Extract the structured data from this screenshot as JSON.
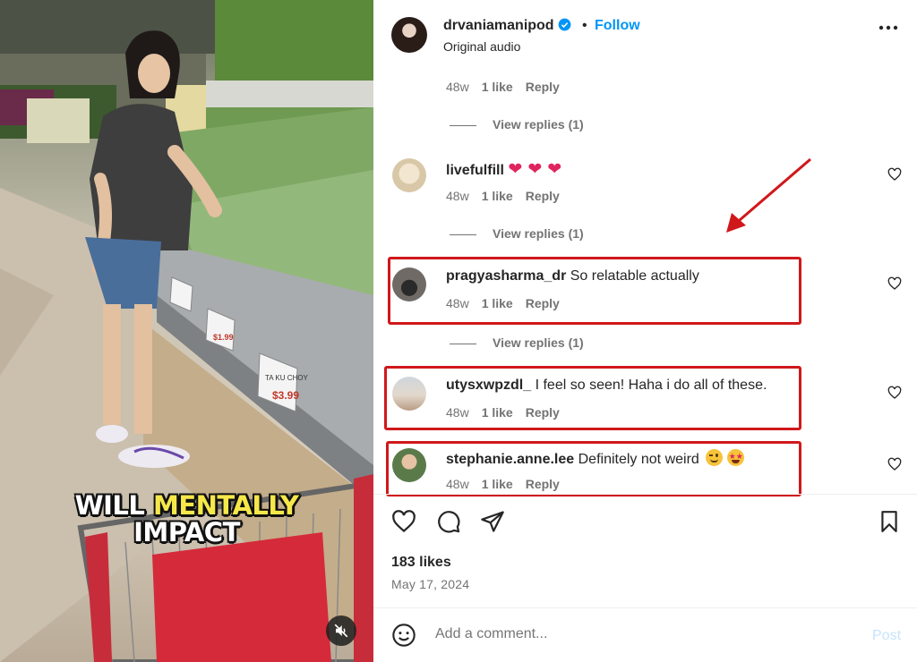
{
  "video": {
    "caption_line1_a": "WILL ",
    "caption_line1_b": "MENTALLY",
    "caption_line2": "IMPACT",
    "caption_highlight_color": "#f7e84a",
    "price_tags": [
      "$1.99",
      "$1.99",
      "$3.99"
    ],
    "tag_label": "TA KU CHOY"
  },
  "header": {
    "username": "drvaniamanipod",
    "separator": "•",
    "follow_label": "Follow",
    "audio_label": "Original audio"
  },
  "comments_top": {
    "meta": {
      "age": "48w",
      "likes": "1 like",
      "reply": "Reply"
    },
    "view_replies": "View replies (1)"
  },
  "comments": [
    {
      "username": "livefulfill",
      "text": "",
      "emoji": "❤️ ❤️ ❤️",
      "age": "48w",
      "likes": "1 like",
      "reply": "Reply",
      "view_replies": "View replies (1)"
    },
    {
      "username": "pragyasharma_dr",
      "text": "So relatable actually",
      "age": "48w",
      "likes": "1 like",
      "reply": "Reply",
      "view_replies": "View replies (1)"
    },
    {
      "username": "utysxwpzdl_",
      "text": "I feel so seen! Haha i do all of these.",
      "age": "48w",
      "likes": "1 like",
      "reply": "Reply"
    },
    {
      "username": "stephanie.anne.lee",
      "text": "Definitely not weird",
      "emoji": "😉🤩",
      "age": "48w",
      "likes": "1 like",
      "reply": "Reply"
    }
  ],
  "footer": {
    "likes": "183 likes",
    "date": "May 17, 2024",
    "comment_placeholder": "Add a comment...",
    "post_label": "Post"
  },
  "colors": {
    "highlight_box": "#d0181b",
    "follow_blue": "#0095f6",
    "meta_gray": "#737373"
  }
}
